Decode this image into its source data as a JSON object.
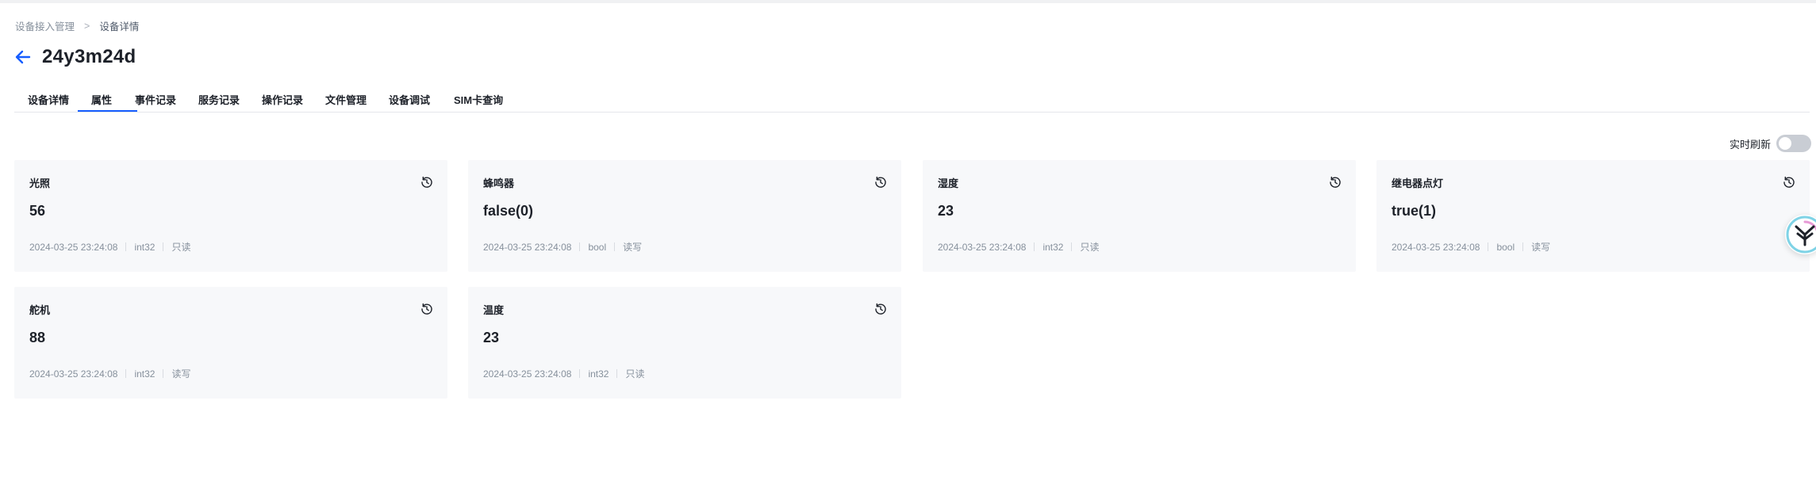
{
  "breadcrumb": {
    "parent": "设备接入管理",
    "separator": ">",
    "current": "设备详情"
  },
  "header": {
    "title": "24y3m24d"
  },
  "tabs": [
    {
      "label": "设备详情"
    },
    {
      "label": "属性",
      "active": true
    },
    {
      "label": "事件记录"
    },
    {
      "label": "服务记录"
    },
    {
      "label": "操作记录"
    },
    {
      "label": "文件管理"
    },
    {
      "label": "设备调试"
    },
    {
      "label": "SIM卡查询"
    }
  ],
  "toolbar": {
    "realtime_refresh_label": "实时刷新",
    "realtime_refresh_on": false
  },
  "properties": [
    {
      "name": "光照",
      "value": "56",
      "time": "2024-03-25 23:24:08",
      "type": "int32",
      "access": "只读"
    },
    {
      "name": "蜂鸣器",
      "value": "false(0)",
      "time": "2024-03-25 23:24:08",
      "type": "bool",
      "access": "读写"
    },
    {
      "name": "湿度",
      "value": "23",
      "time": "2024-03-25 23:24:08",
      "type": "int32",
      "access": "只读"
    },
    {
      "name": "继电器点灯",
      "value": "true(1)",
      "time": "2024-03-25 23:24:08",
      "type": "bool",
      "access": "读写"
    },
    {
      "name": "舵机",
      "value": "88",
      "time": "2024-03-25 23:24:08",
      "type": "int32",
      "access": "读写"
    },
    {
      "name": "温度",
      "value": "23",
      "time": "2024-03-25 23:24:08",
      "type": "int32",
      "access": "只读"
    }
  ],
  "icons": {
    "back": "arrow-left-icon",
    "history": "history-icon",
    "assistant": "assistant-logo-icon"
  },
  "colors": {
    "accent": "#165dff",
    "card_bg": "#f7f8fa",
    "switch_off": "#c9cdd4"
  }
}
